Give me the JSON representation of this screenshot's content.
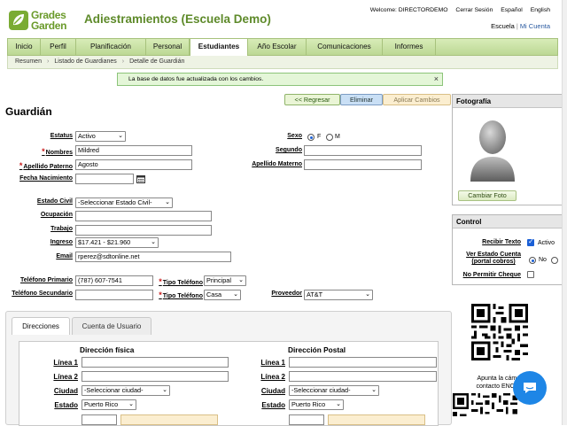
{
  "app": {
    "logo_line1": "Grades",
    "logo_line2": "Garden",
    "title": "Adiestramientos (Escuela Demo)"
  },
  "topnav": {
    "welcome": "Welcome: DIRECTORDEMO",
    "logout": "Cerrar Sesión",
    "lang_es": "Español",
    "lang_en": "English"
  },
  "school": {
    "label": "Escuela",
    "mine": "Mi Cuenta"
  },
  "tabs": [
    "Inicio",
    "Perfil",
    "Planificación",
    "Personal",
    "Estudiantes",
    "Año Escolar",
    "Comunicaciones",
    "Informes"
  ],
  "active_tab": "Estudiantes",
  "breadcrumbs": [
    "Resumen",
    "Listado de Guardianes",
    "Detalle de Guardián"
  ],
  "alert": {
    "message": "La base de datos fue actualizada con los cambios.",
    "close": "×"
  },
  "actions": {
    "back": "<< Regresar",
    "delete": "Eliminar",
    "apply": "Aplicar Cambios"
  },
  "heading": "Guardián",
  "form": {
    "estatus": {
      "label": "Estatus",
      "value": "Activo"
    },
    "nombres": {
      "label": "Nombres",
      "value": "Mildred",
      "required": "*"
    },
    "apellido_paterno": {
      "label": "Apellido Paterno",
      "value": "Agosto",
      "required": "*"
    },
    "fecha_nacimiento": {
      "label": "Fecha Nacimiento",
      "value": ""
    },
    "sexo": {
      "label": "Sexo",
      "option_f": "F",
      "option_m": "M",
      "selected": "F"
    },
    "segundo": {
      "label": "Segundo",
      "value": ""
    },
    "apellido_materno": {
      "label": "Apellido Materno",
      "value": ""
    },
    "estado_civil": {
      "label": "Estado Civil",
      "value": "-Seleccionar Estado Civil-"
    },
    "ocupacion": {
      "label": "Ocupación",
      "value": ""
    },
    "trabajo": {
      "label": "Trabajo",
      "value": ""
    },
    "ingreso": {
      "label": "Ingreso",
      "value": "$17.421 - $21.960"
    },
    "email": {
      "label": "Email",
      "value": "rperez@sdtonline.net"
    },
    "tel_primario": {
      "label": "Teléfono Primario",
      "value": "(787) 607-7541"
    },
    "tipo_tel_1": {
      "label": "Tipo Teléfono",
      "value": "Principal",
      "required": "*"
    },
    "tel_secundario": {
      "label": "Teléfono Secundario",
      "value": ""
    },
    "tipo_tel_2": {
      "label": "Tipo Teléfono",
      "value": "Casa",
      "required": "*"
    },
    "proveedor": {
      "label": "Proveedor",
      "value": "AT&T"
    }
  },
  "photo_panel": {
    "title": "Fotografía",
    "change_button": "Cambiar Foto"
  },
  "control_panel": {
    "title": "Control",
    "recibir_texto": {
      "label": "Recibir Texto",
      "checked": true,
      "state": "Activo"
    },
    "ver_estado_cuenta": {
      "label_line1": "Ver Estado Cuenta",
      "label_line2": "(portal cobros)",
      "option_no": "No",
      "selected": "No"
    },
    "no_permitir_cheque": {
      "label": "No Permitir Cheque",
      "checked": false
    }
  },
  "qr_caption": {
    "line1": "Apunta la cámar",
    "line2": "contacto ENCAD"
  },
  "lower_tabs": [
    "Direcciones",
    "Cuenta de Usuario"
  ],
  "active_lower_tab": "Direcciones",
  "address": {
    "fisica": {
      "title": "Dirección física",
      "linea1": {
        "label": "Línea 1",
        "value": ""
      },
      "linea2": {
        "label": "Línea 2",
        "value": ""
      },
      "ciudad": {
        "label": "Ciudad",
        "value": "-Seleccionar ciudad-"
      },
      "estado": {
        "label": "Estado",
        "value": "Puerto Rico"
      }
    },
    "postal": {
      "title": "Dirección Postal",
      "linea1": {
        "label": "Línea 1",
        "value": ""
      },
      "linea2": {
        "label": "Línea 2",
        "value": ""
      },
      "ciudad": {
        "label": "Ciudad",
        "value": "-Seleccionar ciudad-"
      },
      "estado": {
        "label": "Estado",
        "value": "Puerto Rico"
      }
    }
  },
  "colors": {
    "brand_green": "#5e8a2a",
    "tab_bg": "#c9e2a4",
    "required": "#c81a1a",
    "chat": "#1e86e6"
  }
}
